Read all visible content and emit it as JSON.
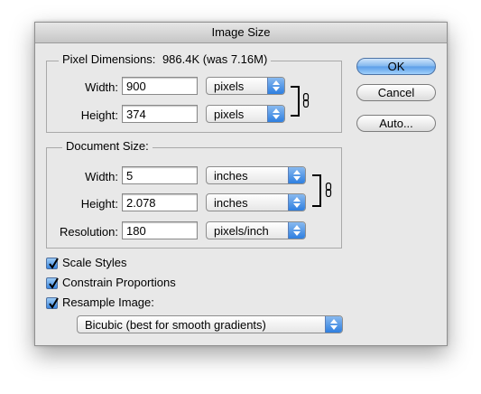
{
  "window": {
    "title": "Image Size"
  },
  "pixel_dimensions": {
    "legend": "Pixel Dimensions:",
    "size": "986.4K (was 7.16M)",
    "width_label": "Width:",
    "width_value": "900",
    "width_unit": "pixels",
    "height_label": "Height:",
    "height_value": "374",
    "height_unit": "pixels"
  },
  "document_size": {
    "legend": "Document Size:",
    "width_label": "Width:",
    "width_value": "5",
    "width_unit": "inches",
    "height_label": "Height:",
    "height_value": "2.078",
    "height_unit": "inches",
    "resolution_label": "Resolution:",
    "resolution_value": "180",
    "resolution_unit": "pixels/inch"
  },
  "options": {
    "scale_styles": "Scale Styles",
    "scale_styles_checked": true,
    "constrain_proportions": "Constrain Proportions",
    "constrain_proportions_checked": true,
    "resample_image": "Resample Image:",
    "resample_image_checked": true,
    "resample_method": "Bicubic (best for smooth gradients)"
  },
  "buttons": {
    "ok": "OK",
    "cancel": "Cancel",
    "auto": "Auto..."
  },
  "colors": {
    "accent": "#3b86df",
    "dialog_bg": "#e8e8e8"
  }
}
